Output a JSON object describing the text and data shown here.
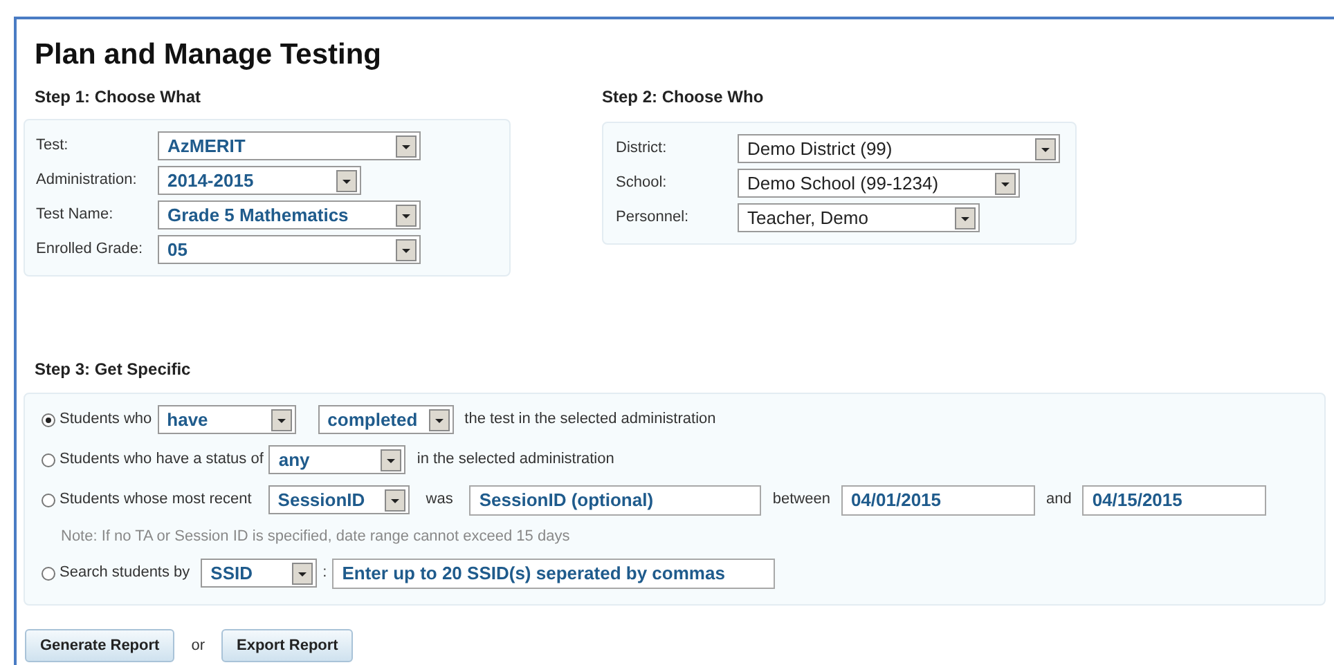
{
  "title": "Plan and Manage Testing",
  "step1": {
    "heading": "Step 1: Choose What",
    "fields": [
      {
        "label": "Test:",
        "value": "AzMERIT",
        "emphasis": true
      },
      {
        "label": "Administration:",
        "value": "2014-2015",
        "emphasis": true
      },
      {
        "label": "Test Name:",
        "value": "Grade 5 Mathematics",
        "emphasis": true
      },
      {
        "label": "Enrolled Grade:",
        "value": "05",
        "emphasis": true
      }
    ]
  },
  "step2": {
    "heading": "Step 2: Choose Who",
    "fields": [
      {
        "label": "District:",
        "value": "Demo District (99)",
        "emphasis": false
      },
      {
        "label": "School:",
        "value": "Demo School (99-1234)",
        "emphasis": false
      },
      {
        "label": "Personnel:",
        "value": "Teacher, Demo",
        "emphasis": false
      }
    ]
  },
  "step3": {
    "heading": "Step 3: Get Specific",
    "rows": [
      {
        "kind": "option",
        "selected": true,
        "parts": [
          {
            "kind": "text",
            "text": "Students who"
          },
          {
            "kind": "select",
            "value": "have"
          },
          {
            "kind": "select",
            "value": "completed"
          },
          {
            "kind": "text",
            "text": "the test in the selected administration"
          }
        ]
      },
      {
        "kind": "option",
        "selected": false,
        "parts": [
          {
            "kind": "text",
            "text": "Students who have a status of"
          },
          {
            "kind": "select",
            "value": "any"
          },
          {
            "kind": "text",
            "text": "in the selected administration"
          }
        ]
      },
      {
        "kind": "option",
        "selected": false,
        "parts": [
          {
            "kind": "text",
            "text": "Students whose most recent"
          },
          {
            "kind": "select",
            "value": "SessionID"
          },
          {
            "kind": "text",
            "text": "was"
          },
          {
            "kind": "input",
            "value": "SessionID (optional)"
          },
          {
            "kind": "text",
            "text": "between"
          },
          {
            "kind": "input",
            "value": "04/01/2015"
          },
          {
            "kind": "text",
            "text": "and"
          },
          {
            "kind": "input",
            "value": "04/15/2015"
          }
        ]
      },
      {
        "kind": "note",
        "text": "Note: If no TA or Session ID is specified, date range cannot exceed 15 days"
      },
      {
        "kind": "option",
        "selected": false,
        "parts": [
          {
            "kind": "text",
            "text": "Search students by"
          },
          {
            "kind": "select",
            "value": "SSID"
          },
          {
            "kind": "text",
            "text": ":"
          },
          {
            "kind": "input",
            "value": "Enter up to 20 SSID(s) seperated by commas"
          }
        ]
      }
    ]
  },
  "actions": [
    {
      "kind": "button",
      "label": "Generate Report"
    },
    {
      "kind": "text",
      "label": "or"
    },
    {
      "kind": "button",
      "label": "Export Report"
    }
  ]
}
